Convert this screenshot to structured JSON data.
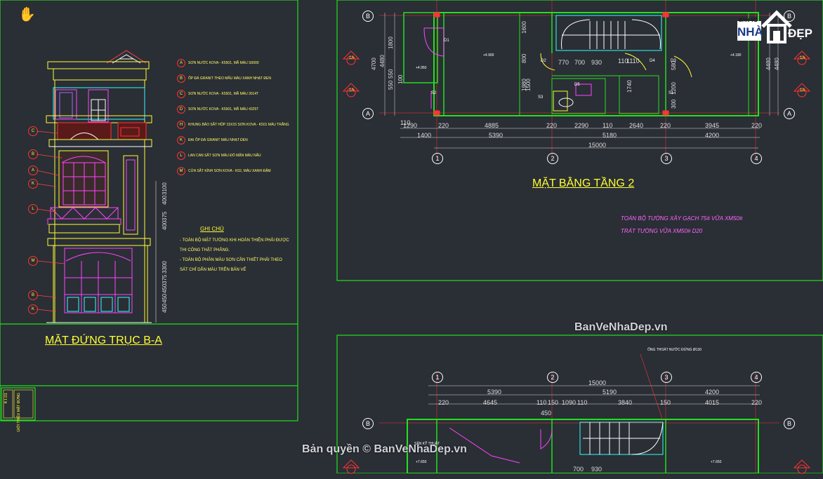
{
  "titles": {
    "elevation": "MẶT ĐỨNG TRỤC B-A",
    "floor2": "MẶT BẰNG TẦNG 2"
  },
  "watermark": {
    "site": "BanVeNhaDep.vn",
    "copyright": "Bản quyền © BanVeNhaDep.vn",
    "logo_top": "BẢN VẼ",
    "logo_nha": "NHÀ",
    "logo_dep": "ĐẸP"
  },
  "wall_note": [
    "TOÀN BỘ TƯỜNG XÂY GẠCH 75# VỮA XM50#",
    "TRÁT TƯỜNG VỮA XM50# D20"
  ],
  "ghi_chu": {
    "heading": "GHI CHÚ",
    "lines": [
      "- TOÀN BỘ MẶT TƯỜNG KHI HOÀN THIỆN PHẢI ĐƯỢC",
      "THI CÔNG THẬT PHẲNG.",
      "- TOÀN BỘ PHẦN MÀU SƠN CẦN THIẾT PHẢI THEO",
      "SÁT CHỈ DẪN MÀU TRÊN BẢN VẼ"
    ]
  },
  "legend": [
    {
      "k": "A",
      "t": "SƠN NƯỚC KOVA - K5501, MÃ MÀU S0000"
    },
    {
      "k": "B",
      "t": "ỐP ĐÁ GRANIT THEO MẪU MÀU XANH NHẠT ĐEN"
    },
    {
      "k": "C",
      "t": "SƠN NƯỚC KOVA - K5501, MÃ MÀU 3014T"
    },
    {
      "k": "D",
      "t": "SƠN NƯỚC KOVA - K5501, MÃ MÀU 4325T"
    },
    {
      "k": "H",
      "t": "KHUNG BẢO SẮT HỘP 15X15 SƠN KOVA - K501 MÀU TRẮNG"
    },
    {
      "k": "K",
      "t": "ĐAI ỐP ĐÁ GRANIT MÀU NHẠT ĐEN"
    },
    {
      "k": "L",
      "t": "LAN CAN SẮT SƠN MÀU ĐỎ MẬN MÀU NÂU"
    },
    {
      "k": "M",
      "t": "CỬA SẮT KÍNH SƠN KOVA - K02, MÀU XANH ĐẬM"
    }
  ],
  "elevation_keys": [
    "C",
    "B",
    "A",
    "K",
    "L",
    "M",
    "B",
    "K"
  ],
  "elevation_dims": [
    "400",
    "3100",
    "375",
    "400",
    "3300",
    "375",
    "450",
    "450",
    "450"
  ],
  "plan_top": {
    "axes": [
      "1",
      "2",
      "3",
      "4"
    ],
    "rows": [
      "B",
      "A"
    ],
    "overall": "15000",
    "spans": [
      "5390",
      "5190",
      "4200"
    ],
    "bottom_row1": [
      "1400",
      "5390",
      "5180",
      "4200"
    ],
    "bottom_row2": [
      "1290",
      "220",
      "4885",
      "220",
      "2290",
      "110",
      "2640",
      "220",
      "3945",
      "220"
    ],
    "interior": [
      "770",
      "700",
      "930",
      "110",
      "1110",
      "1600",
      "800",
      "1980",
      "1500",
      "1740",
      "1200",
      "580",
      "300"
    ],
    "side_left": [
      "4700",
      "4480",
      "1800",
      "550",
      "550",
      "100"
    ],
    "side_right": [
      "4480",
      "4480"
    ],
    "small_label": "110",
    "levels": [
      "+4.900",
      "+4.950",
      "+4.180"
    ],
    "doors": [
      "D1",
      "D2",
      "D3",
      "D4",
      "D5",
      "S1",
      "S2",
      "S3"
    ],
    "sec": "1A"
  },
  "plan_bottom": {
    "overall": "15000",
    "spans": [
      "5390",
      "5190",
      "4200"
    ],
    "row2": [
      "220",
      "4645",
      "110",
      "150",
      "1090",
      "110",
      "3840",
      "150",
      "4015",
      "220"
    ],
    "interior": [
      "450",
      "700",
      "930"
    ],
    "levels": [
      "+7.650",
      "+7.650"
    ],
    "room": "SÂN KỸ THUẬT",
    "note": "ỐNG THOÁT NƯỚC ĐỨNG Ø130"
  },
  "stamp": "GIỚI THIỆU MẶT ĐỨNG",
  "stamp_sub": "KT.01",
  "colors": {
    "bg": "#2a2e35",
    "green": "#22e01f",
    "cyan": "#33ffff",
    "red": "#ff2b2b",
    "yellow": "#ffff33",
    "magenta": "#ff44ff"
  }
}
